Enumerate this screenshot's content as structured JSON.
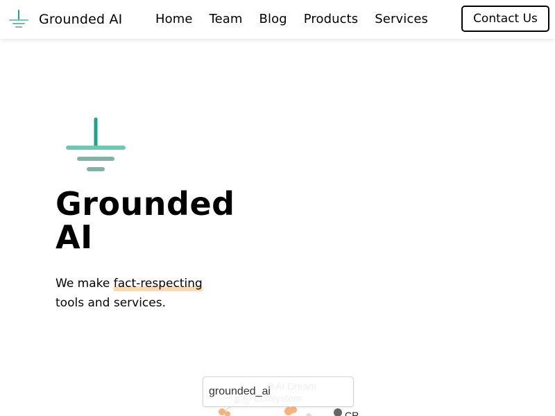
{
  "header": {
    "brand_name": "Grounded AI",
    "nav": [
      "Home",
      "Team",
      "Blog",
      "Products",
      "Services"
    ],
    "contact_label": "Contact Us"
  },
  "hero": {
    "title_line1": "Grounded",
    "title_line2": "AI",
    "tagline_before": "We make ",
    "tagline_highlight": "fact-respecting",
    "tagline_after": "tools and services."
  },
  "graph": {
    "search_value": "grounded_ai",
    "nodes": [
      {
        "label": "AI Dream",
        "color": "#d9d9d9"
      },
      {
        "label": "AI Ecosystem",
        "color": "#d9d9d9"
      },
      {
        "label": "CR",
        "color": "#666666"
      }
    ]
  },
  "colors": {
    "logo_stem": "#1fa388",
    "logo_bar1": "#6fc6b2",
    "logo_bar2": "#7fb3a6",
    "highlight": "#fdd9ab",
    "node_orange": "#f8b27a"
  }
}
